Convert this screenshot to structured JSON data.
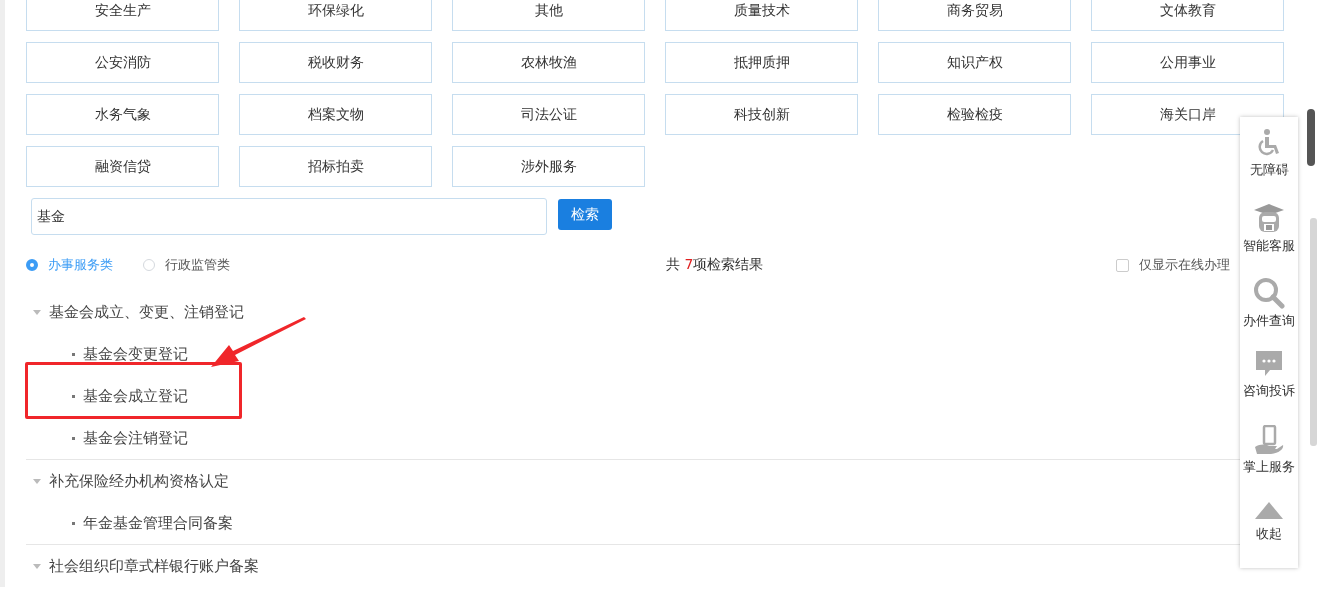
{
  "categories": [
    "安全生产",
    "环保绿化",
    "其他",
    "质量技术",
    "商务贸易",
    "文体教育",
    "公安消防",
    "税收财务",
    "农林牧渔",
    "抵押质押",
    "知识产权",
    "公用事业",
    "水务气象",
    "档案文物",
    "司法公证",
    "科技创新",
    "检验检疫",
    "海关口岸",
    "融资信贷",
    "招标拍卖",
    "涉外服务"
  ],
  "search": {
    "value": "基金",
    "button": "检索"
  },
  "scope": [
    {
      "label": "办事服务类",
      "selected": true
    },
    {
      "label": "行政监管类",
      "selected": false
    }
  ],
  "result_count": {
    "prefix": "共 ",
    "count": "7",
    "suffix": "项检索结果"
  },
  "online_only": {
    "label": "仅显示在线办理",
    "checked": false
  },
  "results": [
    {
      "title": "基金会成立、变更、注销登记",
      "expanded": true,
      "children": [
        {
          "title": "基金会变更登记",
          "highlighted": false
        },
        {
          "title": "基金会成立登记",
          "highlighted": true
        },
        {
          "title": "基金会注销登记",
          "highlighted": false
        }
      ]
    },
    {
      "title": "补充保险经办机构资格认定",
      "expanded": true,
      "children": [
        {
          "title": "年金基金管理合同备案",
          "highlighted": false
        }
      ]
    },
    {
      "title": "社会组织印章式样银行账户备案",
      "expanded": true
    }
  ],
  "side_panel": [
    {
      "kind": "accessibility",
      "label": "无障碍"
    },
    {
      "kind": "robot",
      "label": "智能客服"
    },
    {
      "kind": "search",
      "label": "办件查询"
    },
    {
      "kind": "chat",
      "label": "咨询投诉"
    },
    {
      "kind": "mobile",
      "label": "掌上服务"
    },
    {
      "kind": "collapse",
      "label": "收起"
    }
  ]
}
